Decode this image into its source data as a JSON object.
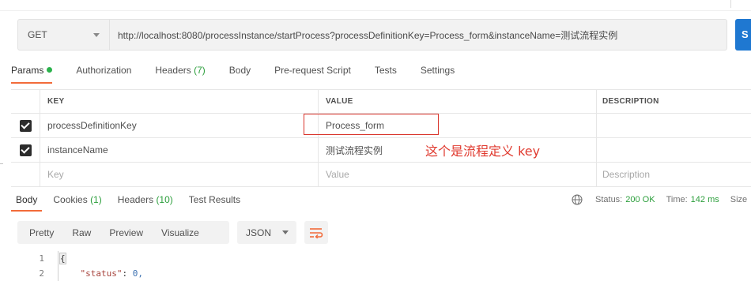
{
  "request": {
    "method": "GET",
    "url": "http://localhost:8080/processInstance/startProcess?processDefinitionKey=Process_form&instanceName=测试流程实例",
    "send_label": "S"
  },
  "request_tabs": [
    {
      "label": "Params",
      "count": "",
      "active": true,
      "dot": true
    },
    {
      "label": "Authorization",
      "count": ""
    },
    {
      "label": "Headers",
      "count": "(7)"
    },
    {
      "label": "Body",
      "count": ""
    },
    {
      "label": "Pre-request Script",
      "count": ""
    },
    {
      "label": "Tests",
      "count": ""
    },
    {
      "label": "Settings",
      "count": ""
    }
  ],
  "params": {
    "headers": {
      "key": "KEY",
      "value": "VALUE",
      "description": "DESCRIPTION"
    },
    "rows": [
      {
        "checked": true,
        "key": "processDefinitionKey",
        "value": "Process_form",
        "description": ""
      },
      {
        "checked": true,
        "key": "instanceName",
        "value": "测试流程实例",
        "description": ""
      }
    ],
    "placeholder": {
      "key": "Key",
      "value": "Value",
      "description": "Description"
    }
  },
  "annotation": "这个是流程定义 key",
  "response_tabs": [
    {
      "label": "Body",
      "count": "",
      "active": true
    },
    {
      "label": "Cookies",
      "count": "(1)"
    },
    {
      "label": "Headers",
      "count": "(10)"
    },
    {
      "label": "Test Results",
      "count": ""
    }
  ],
  "response_status": {
    "status_label": "Status:",
    "status_value": "200 OK",
    "time_label": "Time:",
    "time_value": "142 ms",
    "size_label": "Size"
  },
  "response_view": {
    "modes": [
      "Pretty",
      "Raw",
      "Preview",
      "Visualize"
    ],
    "format": "JSON"
  },
  "code_lines": [
    {
      "num": "1",
      "text": "{"
    },
    {
      "num": "2",
      "key": "\"status\"",
      "value": "0,"
    }
  ],
  "colors": {
    "accent_tab": "#f26b3a",
    "success": "#2b9e3b",
    "annotation": "#e03a2f",
    "send_button": "#1f78d1"
  }
}
